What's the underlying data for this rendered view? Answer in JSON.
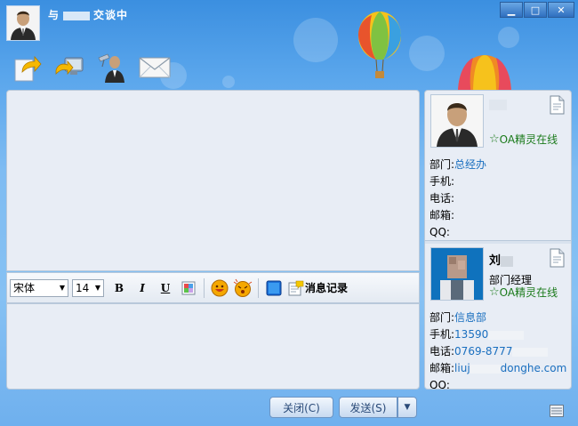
{
  "window": {
    "title_prefix": "与",
    "title_suffix": "交谈中",
    "controls": {
      "minimize": "▁",
      "maximize": "□",
      "close": "✕"
    }
  },
  "toolbar": {
    "items": [
      {
        "icon": "send-file-icon"
      },
      {
        "icon": "remote-desktop-icon"
      },
      {
        "icon": "video-chat-icon"
      },
      {
        "icon": "email-icon"
      }
    ]
  },
  "format_bar": {
    "font_family": "宋体",
    "font_size": "14",
    "bold": "B",
    "italic": "I",
    "underline": "U",
    "history_label": "消息记录"
  },
  "buttons": {
    "close_label": "关闭(C)",
    "send_label": "发送(S)",
    "send_dropdown": "▼"
  },
  "contact_self": {
    "name": "",
    "status": "OA精灵在线",
    "dept_label": "部门:",
    "dept_value": "总经办",
    "mobile_label": "手机:",
    "mobile_value": "",
    "phone_label": "电话:",
    "phone_value": "",
    "email_label": "邮箱:",
    "email_value": "",
    "qq_label": "QQ:",
    "qq_value": ""
  },
  "contact_other": {
    "name": "刘",
    "position": "部门经理",
    "status": "OA精灵在线",
    "dept_label": "部门:",
    "dept_value": "信息部",
    "mobile_label": "手机:",
    "mobile_value": "13590",
    "phone_label": "电话:",
    "phone_value": "0769-8777",
    "email_label": "邮箱:",
    "email_value_start": "liuj",
    "email_value_end": "donghe.com",
    "qq_label": "QQ:",
    "qq_value": ""
  }
}
